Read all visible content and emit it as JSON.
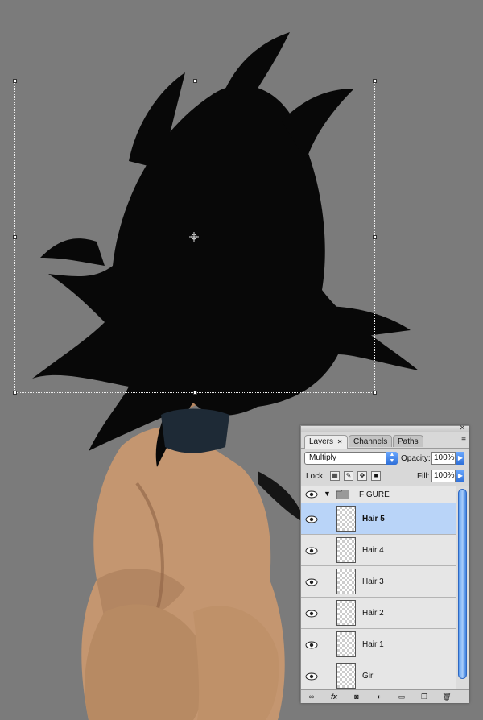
{
  "panel": {
    "tabs": [
      {
        "label": "Layers",
        "active": true
      },
      {
        "label": "Channels",
        "active": false
      },
      {
        "label": "Paths",
        "active": false
      }
    ],
    "blend_mode": "Multiply",
    "opacity_label": "Opacity:",
    "opacity_value": "100%",
    "lock_label": "Lock:",
    "fill_label": "Fill:",
    "fill_value": "100%",
    "group": {
      "name": "FIGURE"
    },
    "layers": [
      {
        "name": "Hair 5",
        "selected": true
      },
      {
        "name": "Hair 4",
        "selected": false
      },
      {
        "name": "Hair 3",
        "selected": false
      },
      {
        "name": "Hair 2",
        "selected": false
      },
      {
        "name": "Hair 1",
        "selected": false
      },
      {
        "name": "Girl",
        "selected": false
      }
    ],
    "bottom_icons": [
      "link-icon",
      "fx-icon",
      "mask-icon",
      "adjustment-icon",
      "folder-icon",
      "new-layer-icon",
      "trash-icon"
    ],
    "fx_label": "fx",
    "close_glyph": "✕",
    "tab_close_glyph": "✕"
  },
  "colors": {
    "canvas_bg": "#7b7b7b",
    "selection": "#b9d4f8",
    "accent": "#2e6fd8"
  }
}
